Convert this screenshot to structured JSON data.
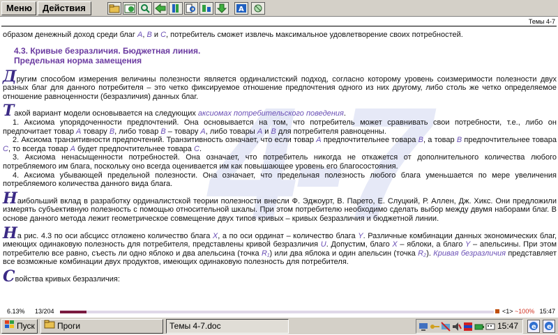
{
  "menubar": {
    "menu_label": "Меню",
    "actions_label": "Действия",
    "toolbar_icons": [
      "folder-icon",
      "open-book-icon",
      "search-icon",
      "back-arrow-icon",
      "bookmark-icon",
      "find-in-page-icon",
      "sort-icon",
      "download-arrow-icon",
      "font-icon",
      "rotate-icon"
    ]
  },
  "document": {
    "header_title": "Темы 4-7",
    "watermark": "4-7",
    "intro": {
      "pre": "образом денежный доход среди благ ",
      "a": "A",
      "c1": ", ",
      "b": "B",
      "c2": " и ",
      "c": "C",
      "post": ", потребитель сможет извлечь максимальное удовлетворение своих потребностей."
    },
    "section_heading_line1": "4.3. Кривые безразличия. Бюджетная линия.",
    "section_heading_line2": "Предельная норма замещения",
    "para1": {
      "cap": "Д",
      "text": "ругим способом измерения величины полезности является ординалистский подход, согласно которому уровень соизмеримости полезности двух разных благ для данного потребителя – это четко фиксируемое отношение предпочтения одного из них другому, либо столь же четко определяемое отношение равноценности (безразличия) данных благ."
    },
    "para2": {
      "cap": "Т",
      "text": "акой вариант модели основывается на следующих ",
      "link": "аксиомах потребительского поведения",
      "end": "."
    },
    "axiom1": {
      "pre": "1. Аксиома упорядоченности предпочтений. Она основывается на том, что потребитель может сравнивать свои потребности, т.е., либо он предпочитает товар ",
      "a": "A",
      "m1": " товару ",
      "b": "B",
      "m2": ", либо товар ",
      "b2": "B",
      "m3": " – товару ",
      "a2": "A",
      "m4": ", либо товары ",
      "a3": "A",
      "m5": " и ",
      "b3": "B",
      "post": " для потребителя равноценны."
    },
    "axiom2": {
      "pre": "2. Аксиома транзитивности предпочтений. Транзитивность означает, что если товар ",
      "a": "A",
      "m1": " предпочтительнее товара ",
      "b": "B",
      "m2": ", а товар ",
      "b2": "B",
      "m3": " предпочтительнее товара ",
      "c": "C",
      "m4": ", то всегда товар ",
      "a2": "A",
      "m5": " будет предпочтительнее товара ",
      "c2": "C",
      "post": "."
    },
    "axiom3": "3. Аксиома ненасыщенности потребностей. Она означает, что потребитель никогда не откажется от дополнительного количества любого потребляемого им блага, поскольку оно всегда оценивается им как повышающее уровень его благосостояния.",
    "axiom4": "4. Аксиома убывающей предельной полезности. Она означает, что предельная полезность любого блага уменьшается по мере увеличения потребляемого количества данного вида блага.",
    "para3": {
      "cap": "Н",
      "text": "аибольший вклад в разработку ординалистской теории полезности внесли Ф. Эджоурт, В. Парето, Е. Слуцкий, Р. Аллен, Дж. Хикс. Они предложили измерять субъективную полезность с помощью относительной шкалы. При этом потребителю необходимо сделать выбор между двумя наборами благ. В основе данного метода лежит геометрическое совмещение двух типов кривых – кривых безразличия и бюджетной линии."
    },
    "para4": {
      "cap": "Н",
      "s1": "а рис. 4.3 по оси абсцисс отложено количество блага ",
      "x": "X",
      "s2": ", а по оси ординат – количество блага ",
      "y": "Y",
      "s3": ". Различные комбинации данных экономических благ, имеющих одинаковую полезность для потребителя, представлены кривой безразличия ",
      "u": "U",
      "s4": ". Допустим, благо ",
      "x2": "X",
      "s5": " – яблоки, а благо ",
      "y2": "Y",
      "s6": " – апельсины. При этом потребителю все равно, съесть ли одно яблоко и два апельсина (точка ",
      "r1": "R₁",
      "s7": ") или два яблока и один апельсин (точка ",
      "r2": "R₂",
      "s8": "). ",
      "link": "Кривая безразличия",
      "s9": " представляет все возможные комбинации двух продуктов, имеющих одинаковую полезность для потребителя."
    },
    "para5": {
      "cap": "С",
      "text": "войства кривых безразличия:"
    }
  },
  "status": {
    "percent": "6.13%",
    "page": "13/204",
    "progress": 0.0613,
    "nav": "<1>",
    "zoom": "~100%",
    "time": "15:47"
  },
  "taskbar": {
    "start_label": "Пуск",
    "progi_label": "Проги",
    "doc_label": "Темы 4-7.doc",
    "clock": "15:47"
  }
}
